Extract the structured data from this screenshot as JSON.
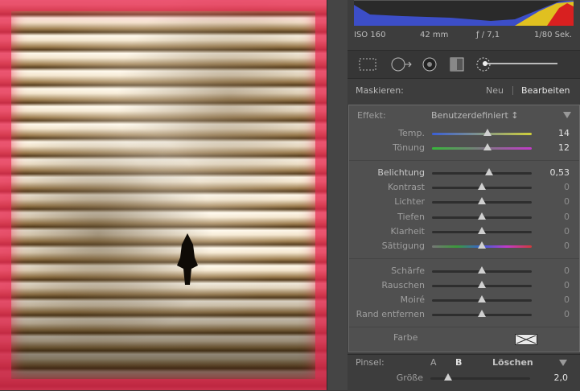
{
  "exif": {
    "iso": "ISO 160",
    "focal": "42 mm",
    "aperture": "ƒ / 7,1",
    "shutter": "1/80 Sek."
  },
  "masking": {
    "label": "Maskieren:",
    "new": "Neu",
    "edit": "Bearbeiten"
  },
  "effect": {
    "label": "Effekt:",
    "preset": "Benutzerdefiniert ↕"
  },
  "sliders_top": [
    {
      "name": "Temp.",
      "value": "14",
      "pos": 0.56
    },
    {
      "name": "Tönung",
      "value": "12",
      "pos": 0.56
    }
  ],
  "sliders_tone": [
    {
      "name": "Belichtung",
      "value": "0,53",
      "pos": 0.57
    },
    {
      "name": "Kontrast",
      "value": "0",
      "pos": 0.5
    },
    {
      "name": "Lichter",
      "value": "0",
      "pos": 0.5
    },
    {
      "name": "Tiefen",
      "value": "0",
      "pos": 0.5
    },
    {
      "name": "Klarheit",
      "value": "0",
      "pos": 0.5
    },
    {
      "name": "Sättigung",
      "value": "0",
      "pos": 0.5
    }
  ],
  "sliders_detail": [
    {
      "name": "Schärfe",
      "value": "0",
      "pos": 0.5
    },
    {
      "name": "Rauschen",
      "value": "0",
      "pos": 0.5
    },
    {
      "name": "Moiré",
      "value": "0",
      "pos": 0.5
    },
    {
      "name": "Rand entfernen",
      "value": "0",
      "pos": 0.5
    }
  ],
  "color": {
    "label": "Farbe"
  },
  "brush": {
    "label": "Pinsel:",
    "a": "A",
    "b": "B",
    "clear": "Löschen",
    "size_label": "Größe",
    "size_value": "2,0",
    "size_pos": 0.18
  },
  "colors": {
    "mask_overlay": "#e62850",
    "panel": "#505050"
  }
}
